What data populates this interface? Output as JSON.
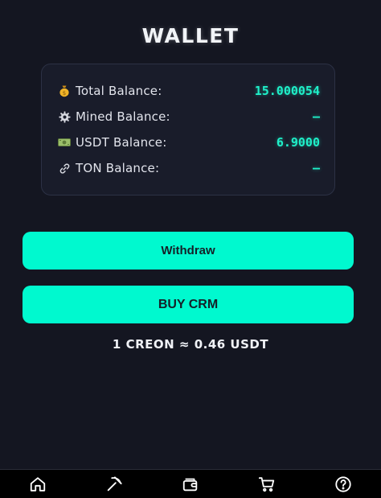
{
  "page": {
    "title": "WALLET"
  },
  "balances": [
    {
      "icon": "money-bag-icon",
      "label": "Total Balance:",
      "value": "15.000054"
    },
    {
      "icon": "gear-icon",
      "label": "Mined Balance:",
      "value": "–"
    },
    {
      "icon": "dollar-banknote-icon",
      "label": "USDT Balance:",
      "value": "6.9000"
    },
    {
      "icon": "link-icon",
      "label": "TON Balance:",
      "value": "–"
    }
  ],
  "actions": {
    "withdraw_label": "Withdraw",
    "buy_label": "BUY CRM"
  },
  "rate_text": "1 CREON ≈ 0.46 USDT",
  "nav": {
    "items": [
      {
        "icon": "home-icon"
      },
      {
        "icon": "pickaxe-icon"
      },
      {
        "icon": "wallet-icon"
      },
      {
        "icon": "cart-icon"
      },
      {
        "icon": "help-icon"
      }
    ]
  },
  "colors": {
    "background": "#141621",
    "accent": "#00f9cf",
    "value_text": "#1ff0c9",
    "card_border": "#2c3145"
  }
}
